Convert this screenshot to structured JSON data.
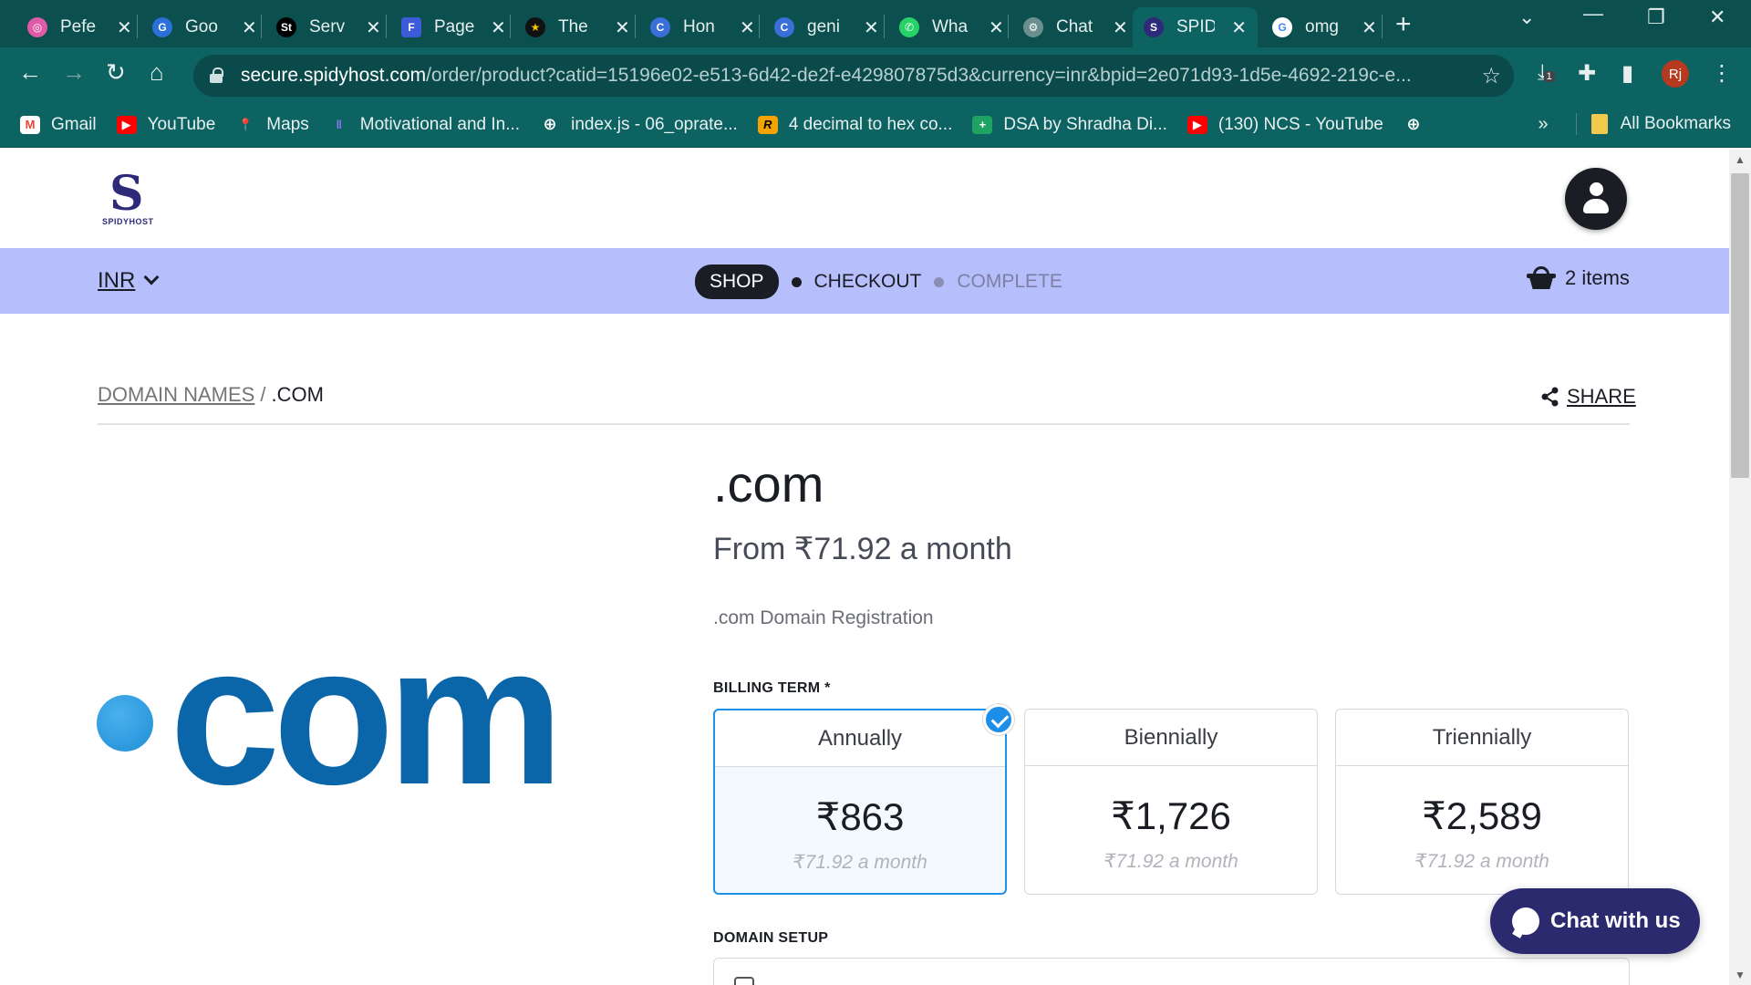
{
  "browser": {
    "tabs": [
      {
        "title": "Pefe",
        "fav_color": "#e05aa7",
        "fav_glyph": "◎"
      },
      {
        "title": "Goo",
        "fav_color": "#2a70d8",
        "fav_glyph": "G"
      },
      {
        "title": "Serv",
        "fav_color": "#000000",
        "fav_glyph": "St"
      },
      {
        "title": "Page",
        "fav_color": "#3d5bd9",
        "fav_glyph": "F"
      },
      {
        "title": "The",
        "fav_color": "#111111",
        "fav_glyph": "★"
      },
      {
        "title": "Hon",
        "fav_color": "#3b6fd8",
        "fav_glyph": "C"
      },
      {
        "title": "geni",
        "fav_color": "#3b6fd8",
        "fav_glyph": "C"
      },
      {
        "title": "Wha",
        "fav_color": "#25d366",
        "fav_glyph": "✆"
      },
      {
        "title": "Chat",
        "fav_color": "#6b8f8f",
        "fav_glyph": "⚙"
      },
      {
        "title": "SPID",
        "fav_color": "#2e2a7a",
        "fav_glyph": "S"
      },
      {
        "title": "omg",
        "fav_color": "#ffffff",
        "fav_glyph": "G"
      }
    ],
    "url_host": "secure.spidyhost.com",
    "url_path": "/order/product?catid=15196e02-e513-6d42-de2f-e429807875d3&currency=inr&bpid=2e071d93-1d5e-4692-219c-e...",
    "profile_initials": "Rj",
    "download_badge": "1",
    "bookmarks": [
      {
        "label": "Gmail",
        "color": "#ea4335",
        "glyph": "M"
      },
      {
        "label": "YouTube",
        "color": "#ff0000",
        "glyph": "▶"
      },
      {
        "label": "Maps",
        "color": "#34a853",
        "glyph": "⬤"
      },
      {
        "label": "Motivational and In...",
        "color": "#6a5acd",
        "glyph": "‖"
      },
      {
        "label": "index.js - 06_oprate...",
        "color": "#0d6262",
        "glyph": "⊕"
      },
      {
        "label": "4 decimal to hex co...",
        "color": "#f4a300",
        "glyph": "R"
      },
      {
        "label": "DSA by Shradha Di...",
        "color": "#1ea362",
        "glyph": "+"
      },
      {
        "label": "(130) NCS - YouTube",
        "color": "#ff0000",
        "glyph": "▶"
      }
    ],
    "bookmarks_overflow": "»",
    "all_bookmarks": "All Bookmarks"
  },
  "site": {
    "logo_text": "SPIDYHOST",
    "logo_mark": "S",
    "currency": "INR",
    "steps": {
      "shop": "SHOP",
      "checkout": "CHECKOUT",
      "complete": "COMPLETE"
    },
    "cart": "2 items",
    "breadcrumb": {
      "parent": "DOMAIN NAMES",
      "sep": "/",
      "current": ".COM"
    },
    "share": "SHARE"
  },
  "product": {
    "logo_word": "com",
    "title": ".com",
    "price": "From ₹71.92 a month",
    "description": ".com Domain Registration",
    "billing_label": "BILLING TERM *",
    "terms": [
      {
        "name": "Annually",
        "price": "₹863",
        "monthly": "₹71.92 a month",
        "selected": true
      },
      {
        "name": "Biennially",
        "price": "₹1,726",
        "monthly": "₹71.92 a month",
        "selected": false
      },
      {
        "name": "Triennially",
        "price": "₹2,589",
        "monthly": "₹71.92 a month",
        "selected": false
      }
    ],
    "domain_setup_label": "DOMAIN SETUP"
  },
  "chat": {
    "label": "Chat with us"
  },
  "colors": {
    "brand": "#2e2a7a",
    "stepbar": "#b7befc",
    "accent": "#1e90e6",
    "chat": "#2b2a6e"
  }
}
